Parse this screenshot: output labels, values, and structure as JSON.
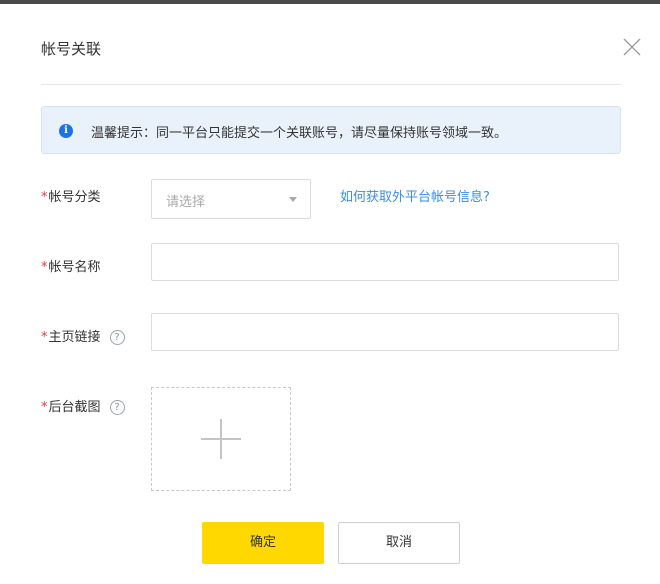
{
  "dialog": {
    "title": "帐号关联",
    "close_icon": "close-icon"
  },
  "tip": {
    "icon": "info-icon",
    "icon_glyph": "i",
    "text": "温馨提示：同一平台只能提交一个关联账号，请尽量保持账号领域一致。"
  },
  "form": {
    "category": {
      "required_mark": "*",
      "label": "帐号分类",
      "placeholder": "请选择",
      "help_link": "如何获取外平台帐号信息?"
    },
    "name": {
      "required_mark": "*",
      "label": "帐号名称",
      "value": ""
    },
    "homepage": {
      "required_mark": "*",
      "label": "主页链接",
      "help_glyph": "?",
      "value": ""
    },
    "screenshot": {
      "required_mark": "*",
      "label": "后台截图",
      "help_glyph": "?",
      "upload_icon": "plus-icon"
    }
  },
  "buttons": {
    "confirm": "确定",
    "cancel": "取消"
  },
  "colors": {
    "confirm_bg": "#ffd800",
    "link": "#3a8ee6",
    "required": "#e4393c",
    "tip_bg": "#e9f1fa"
  }
}
